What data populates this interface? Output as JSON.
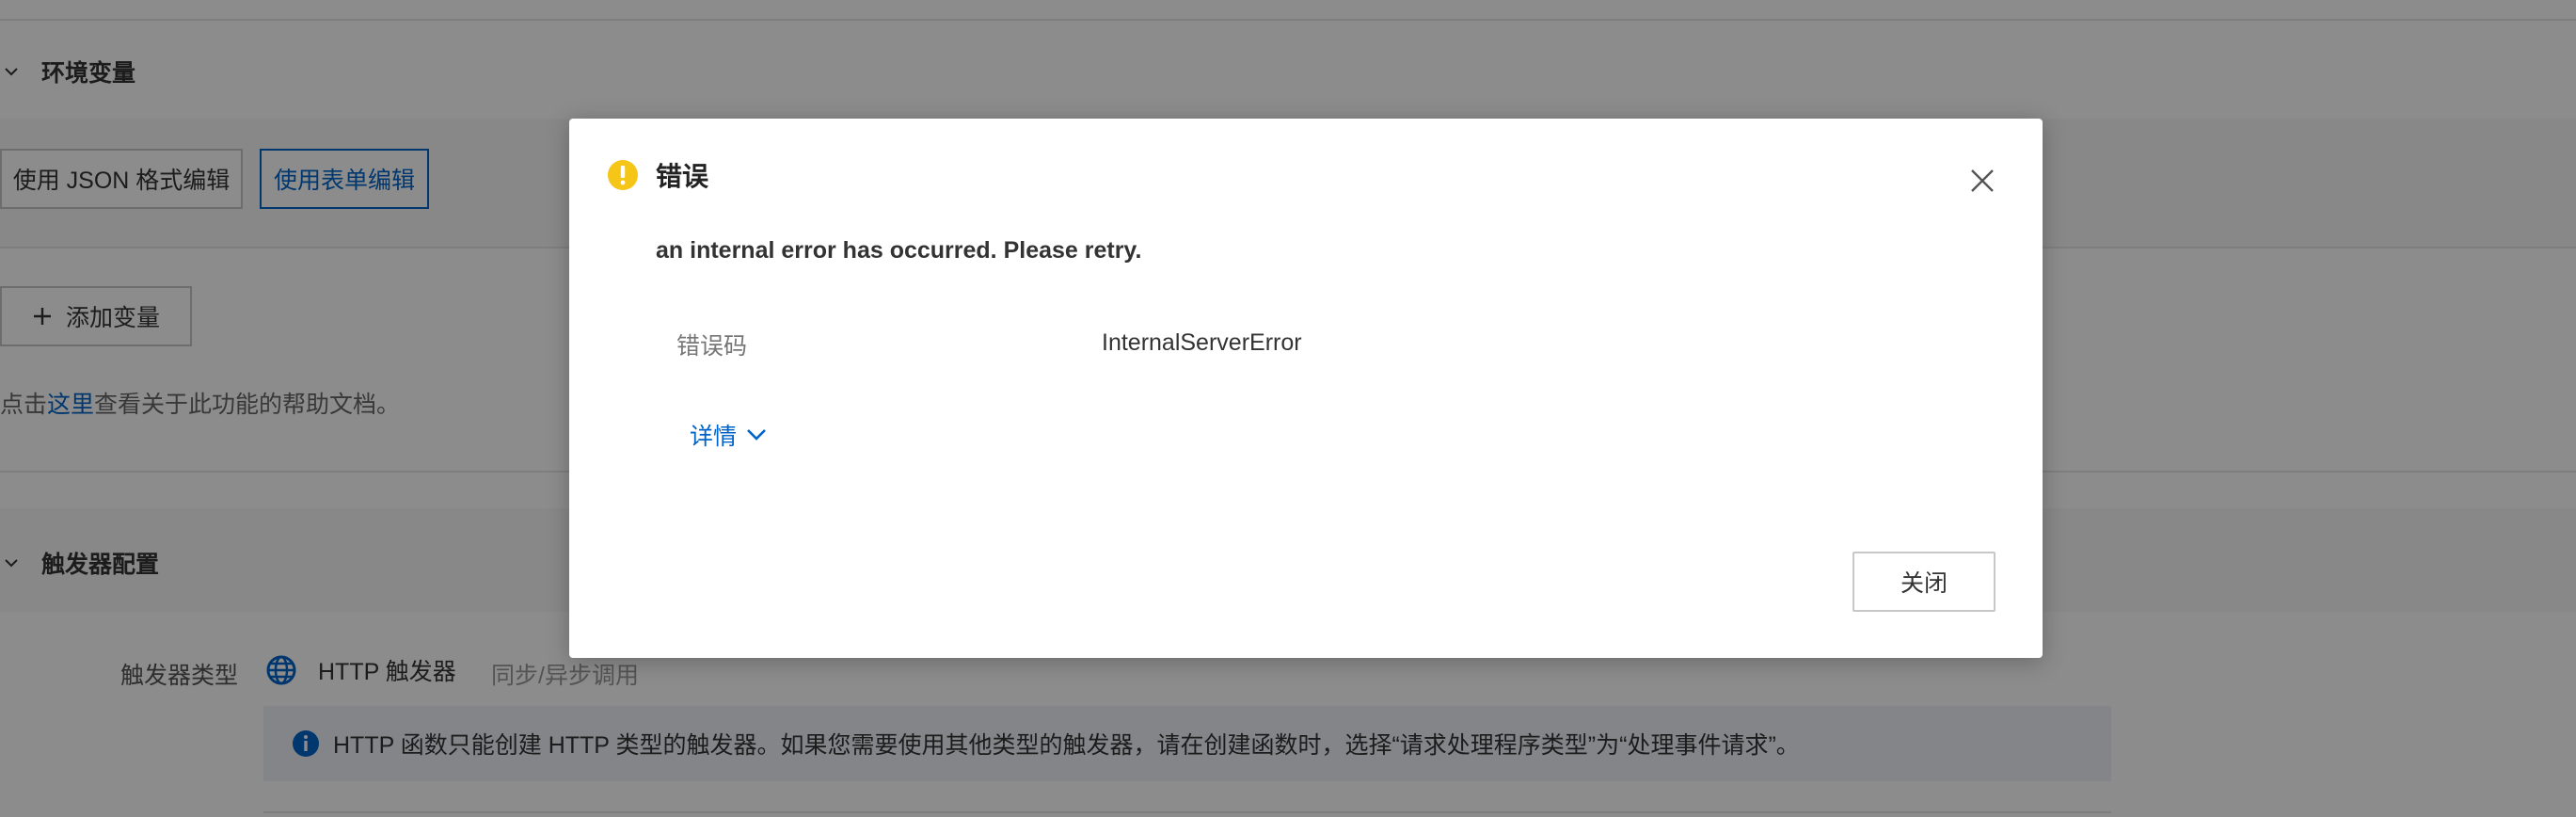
{
  "background": {
    "env_section": {
      "title": "环境变量"
    },
    "edit_mode": {
      "json_label": "使用 JSON 格式编辑",
      "form_label": "使用表单编辑"
    },
    "add_variable": {
      "label": "添加变量"
    },
    "help": {
      "prefix": "点击",
      "link": "这里",
      "suffix": "查看关于此功能的帮助文档。"
    },
    "trigger_section": {
      "title": "触发器配置"
    },
    "trigger": {
      "type_label": "触发器类型",
      "type_value": "HTTP 触发器",
      "type_sub": "同步/异步调用",
      "info": "HTTP 函数只能创建 HTTP 类型的触发器。如果您需要使用其他类型的触发器，请在创建函数时，选择“请求处理程序类型”为“处理事件请求”。"
    }
  },
  "modal": {
    "title": "错误",
    "message": "an internal error has occurred. Please retry.",
    "error_code_label": "错误码",
    "error_code_value": "InternalServerError",
    "details_label": "详情",
    "close_button": "关闭"
  },
  "colors": {
    "accent": "#0064c8",
    "warning": "#f5c518",
    "overlay": "rgba(0,0,0,0.45)"
  },
  "icons": [
    "chevron-down-icon",
    "plus-icon",
    "globe-icon",
    "info-icon",
    "warning-icon",
    "close-icon"
  ]
}
